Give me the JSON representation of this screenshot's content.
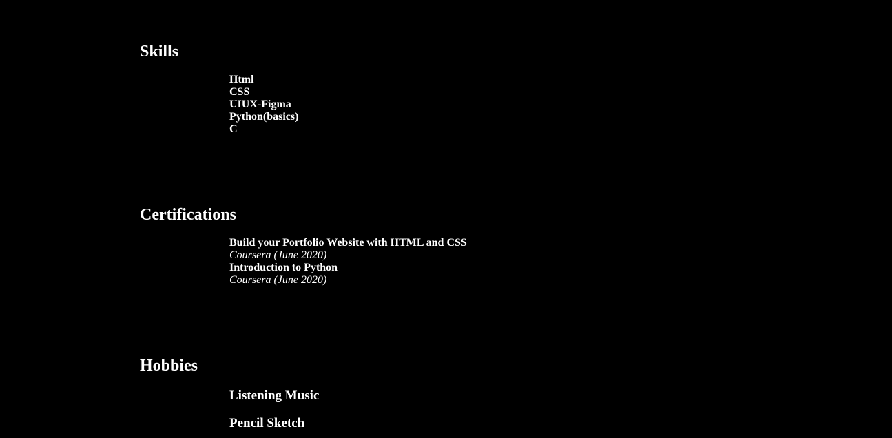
{
  "skills": {
    "title": "Skills",
    "items": [
      "Html",
      "CSS",
      "UIUX-Figma",
      "Python(basics)",
      "C"
    ]
  },
  "certifications": {
    "title": "Certifications",
    "items": [
      {
        "name": "Build your Portfolio Website with HTML and CSS",
        "meta": "Coursera (June 2020)"
      },
      {
        "name": "Introduction to Python",
        "meta": "Coursera (June 2020)"
      }
    ]
  },
  "hobbies": {
    "title": "Hobbies",
    "items": [
      "Listening Music",
      "Pencil Sketch"
    ]
  },
  "colors": {
    "background": "#000000",
    "text": "#ffffff"
  }
}
